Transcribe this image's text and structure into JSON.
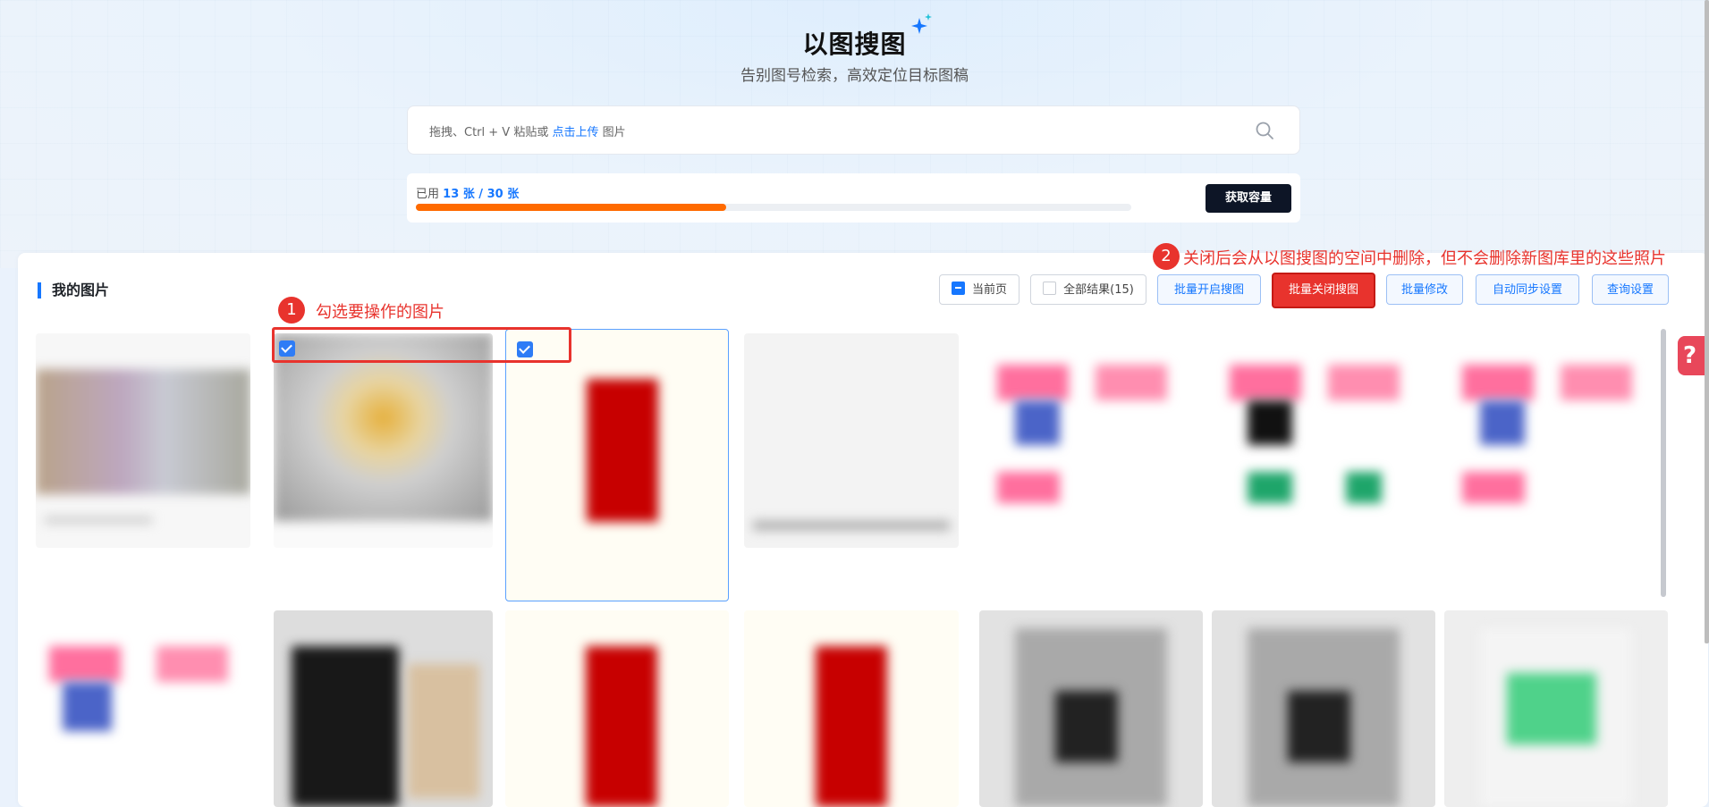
{
  "header": {
    "title": "以图搜图",
    "subtitle": "告别图号检索，高效定位目标图稿"
  },
  "search": {
    "hint_prefix": "拖拽、Ctrl + V 粘贴或",
    "upload_link": "点击上传",
    "hint_suffix": "图片"
  },
  "quota": {
    "used_label": "已用",
    "used_value": "13 张 / 30 张",
    "used": 13,
    "total": 30,
    "button_label": "获取容量",
    "bar_color": "#ff6a00"
  },
  "gallery": {
    "section_title": "我的图片",
    "toolbar": {
      "current_page": "当前页",
      "all_results": "全部结果(15)",
      "batch_enable": "批量开启搜图",
      "batch_disable": "批量关闭搜图",
      "batch_edit": "批量修改",
      "auto_sync": "自动同步设置",
      "query_settings": "查询设置"
    }
  },
  "annotations": {
    "step1_number": "1",
    "step1_text": "勾选要操作的图片",
    "step2_number": "2",
    "step2_text": "关闭后会从以图搜图的空间中删除，但不会删除新图库里的这些照片"
  },
  "colors": {
    "accent": "#1677ff",
    "danger": "#e8332d",
    "dark_button": "#0d1526"
  },
  "icons": {
    "search": "search-icon",
    "sparkle": "sparkle-icon",
    "help": "help-icon"
  },
  "help": {
    "label": "?"
  }
}
